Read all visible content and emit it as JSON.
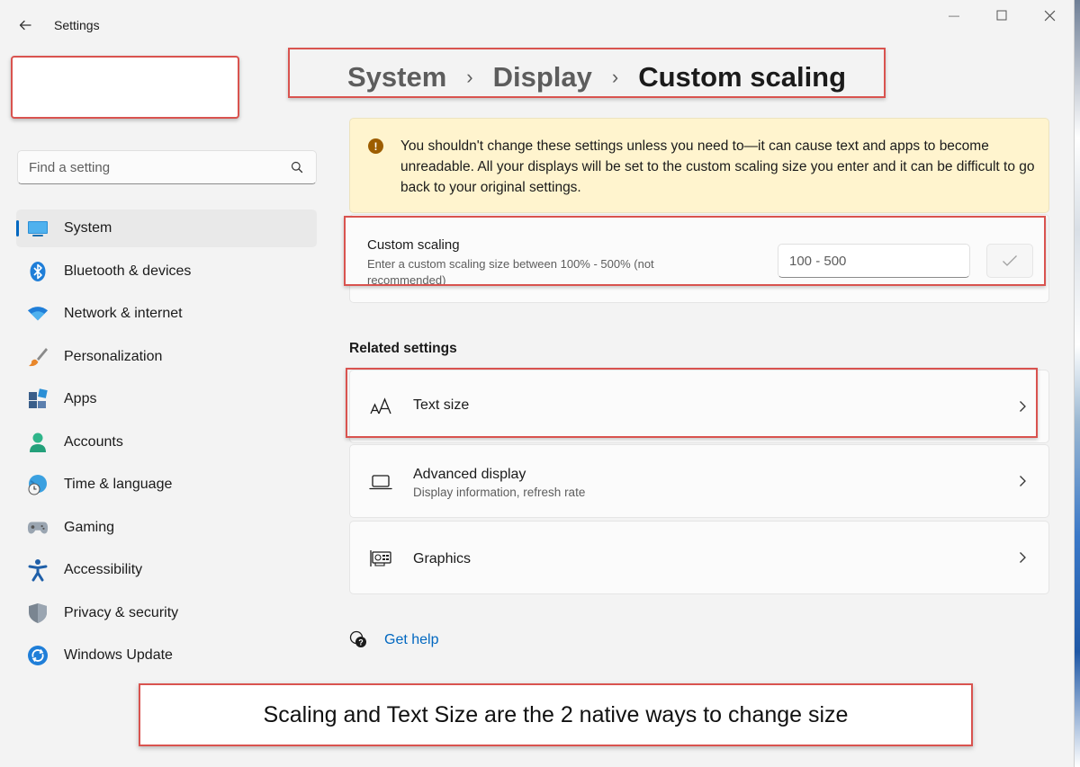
{
  "window": {
    "title": "Settings",
    "minimize": "—",
    "maximize": "☐",
    "close": "✕"
  },
  "search": {
    "placeholder": "Find a setting"
  },
  "sidebar": {
    "items": [
      {
        "label": "System",
        "icon": "monitor-icon",
        "active": true
      },
      {
        "label": "Bluetooth & devices",
        "icon": "bluetooth-icon"
      },
      {
        "label": "Network & internet",
        "icon": "wifi-icon"
      },
      {
        "label": "Personalization",
        "icon": "brush-icon"
      },
      {
        "label": "Apps",
        "icon": "apps-icon"
      },
      {
        "label": "Accounts",
        "icon": "person-icon"
      },
      {
        "label": "Time & language",
        "icon": "globe-clock-icon"
      },
      {
        "label": "Gaming",
        "icon": "gamepad-icon"
      },
      {
        "label": "Accessibility",
        "icon": "accessibility-icon"
      },
      {
        "label": "Privacy & security",
        "icon": "shield-icon"
      },
      {
        "label": "Windows Update",
        "icon": "update-icon"
      }
    ]
  },
  "breadcrumb": {
    "system": "System",
    "display": "Display",
    "current": "Custom scaling",
    "separator": "›"
  },
  "warning": {
    "icon": "!",
    "text": "You shouldn't change these settings unless you need to—it can cause text and apps to become unreadable. All your displays will be set to the custom scaling size you enter and it can be difficult to go back to your original settings."
  },
  "custom_scaling": {
    "title": "Custom scaling",
    "description": "Enter a custom scaling size between 100% - 500% (not recommended)",
    "placeholder": "100 - 500",
    "value": ""
  },
  "related": {
    "heading": "Related settings",
    "items": [
      {
        "title": "Text size",
        "subtitle": ""
      },
      {
        "title": "Advanced display",
        "subtitle": "Display information, refresh rate"
      },
      {
        "title": "Graphics",
        "subtitle": ""
      }
    ]
  },
  "help": {
    "label": "Get help"
  },
  "caption": {
    "text": "Scaling and Text Size are the 2 native ways to change size"
  },
  "colors": {
    "accent": "#0067c0",
    "annotation": "#d9534f",
    "warning_bg": "#fff4ce"
  }
}
